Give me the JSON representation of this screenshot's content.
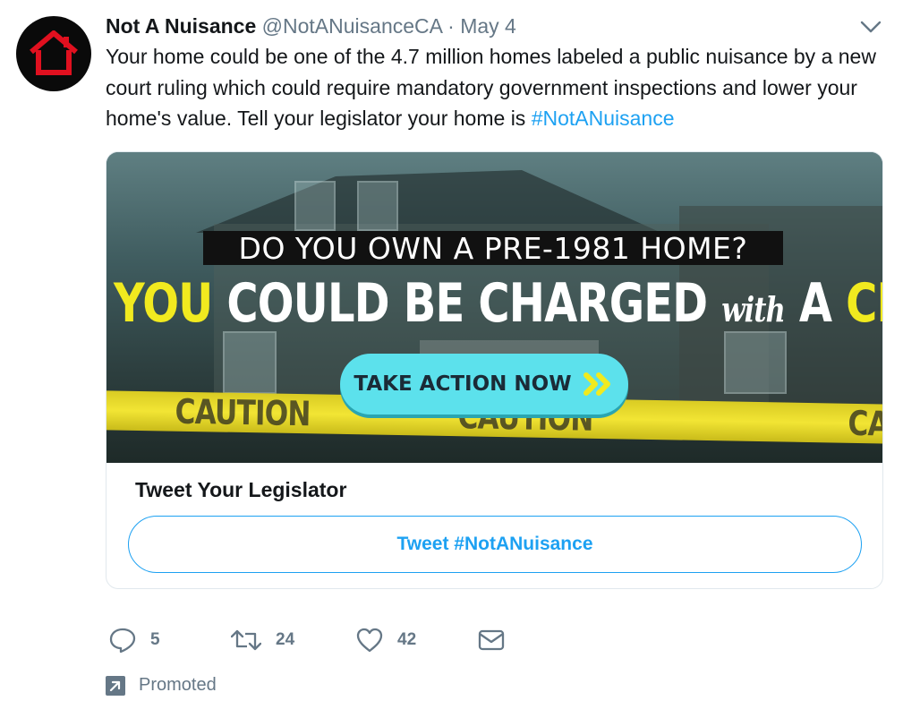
{
  "tweet": {
    "display_name": "Not A Nuisance",
    "handle": "@NotANuisanceCA",
    "separator": "·",
    "date": "May 4",
    "text_before": "Your home could be one of the 4.7 million homes labeled a public nuisance by a new court ruling which could require mandatory government inspections and lower your home's value. Tell your legislator your home is ",
    "hashtag": "#NotANuisance"
  },
  "card": {
    "image": {
      "headline": "DO YOU OWN A PRE-1981 HOME?",
      "line_part1": "YOU",
      "line_part2": "COULD BE CHARGED",
      "line_part3": "with",
      "line_part4": "A",
      "line_part5": "CRIME.",
      "cta_label": "TAKE ACTION NOW",
      "tape_words": [
        "CAUTION",
        "CAUTION",
        "CAUTION"
      ]
    },
    "title": "Tweet Your Legislator",
    "button_label": "Tweet #NotANuisance"
  },
  "actions": {
    "replies": "5",
    "retweets": "24",
    "likes": "42"
  },
  "promoted": {
    "label": "Promoted"
  },
  "colors": {
    "accent": "#1da1f2",
    "secondary_text": "#657786",
    "avatar_red": "#e0101f",
    "banner_yellow": "#f1ea1f",
    "cta_cyan": "#5ce1ec"
  },
  "icons": [
    "house-logo-icon",
    "chevron-down-icon",
    "reply-icon",
    "retweet-icon",
    "like-icon",
    "direct-message-icon",
    "promoted-arrow-icon",
    "double-chevron-right-icon"
  ]
}
